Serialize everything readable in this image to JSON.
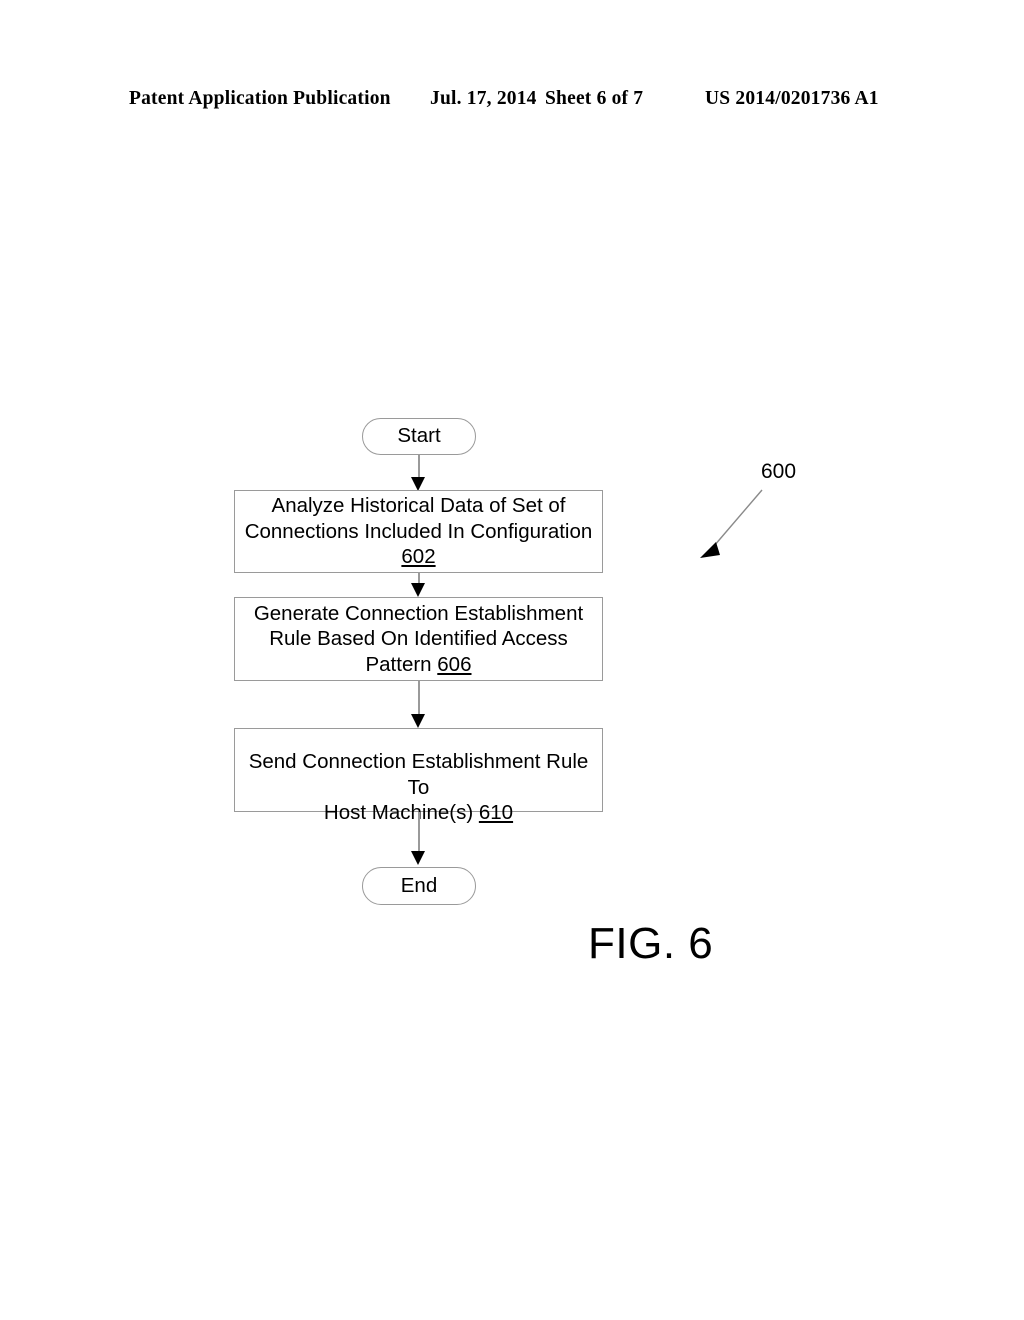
{
  "header": {
    "publication": "Patent Application Publication",
    "date": "Jul. 17, 2014",
    "sheet": "Sheet 6 of 7",
    "patent_number": "US 2014/0201736 A1"
  },
  "figure": {
    "caption": "FIG. 6",
    "reference_numeral": "600"
  },
  "flowchart": {
    "start_label": "Start",
    "end_label": "End",
    "steps": [
      {
        "id": "602",
        "line1": "Analyze Historical Data of Set of",
        "line2": "Connections Included In Configuration",
        "line3": "602",
        "refnum_inline": false
      },
      {
        "id": "606",
        "line1": "Generate Connection Establishment",
        "line2": "Rule Based On Identified Access",
        "line3": "Pattern ",
        "refnum": "606",
        "refnum_inline": true
      },
      {
        "id": "610",
        "line1": "Send Connection Establishment Rule To",
        "line2": "Host Machine(s) ",
        "refnum": "610",
        "refnum_inline": true
      }
    ]
  },
  "colors": {
    "ink": "#000000",
    "outline": "#9a9a9a",
    "page": "#ffffff"
  }
}
